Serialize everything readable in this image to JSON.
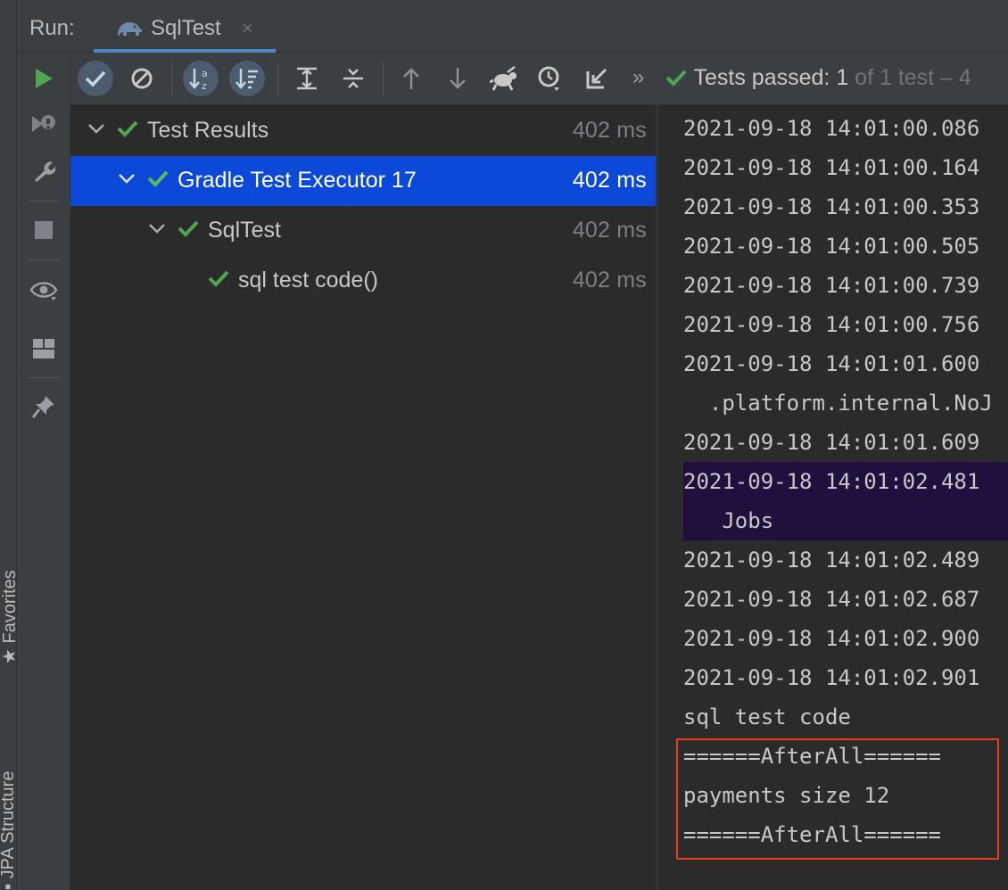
{
  "side_tabs": {
    "favorites": "Favorites",
    "jpa_structure": "JPA Structure"
  },
  "run_panel": {
    "label": "Run:",
    "tab": {
      "title": "SqlTest",
      "close": "×"
    }
  },
  "status": {
    "prefix": "Tests passed:",
    "count": "1",
    "suffix": "of 1 test – 4"
  },
  "toolbar": {
    "more": "»",
    "buttons": [
      "rerun-icon",
      "show-passed-icon",
      "show-ignored-icon",
      "sort-alpha-icon",
      "sort-duration-icon",
      "expand-all-icon",
      "collapse-all-icon",
      "prev-failed-icon",
      "next-failed-icon",
      "import-tests-icon",
      "history-icon",
      "export-icon"
    ]
  },
  "tree": {
    "rows": [
      {
        "label": "Test Results",
        "duration": "402 ms"
      },
      {
        "label": "Gradle Test Executor 17",
        "duration": "402 ms"
      },
      {
        "label": "SqlTest",
        "duration": "402 ms"
      },
      {
        "label": "sql test code()",
        "duration": "402 ms"
      }
    ]
  },
  "console": {
    "lines": [
      "2021-09-18 14:01:00.086",
      "2021-09-18 14:01:00.164",
      "2021-09-18 14:01:00.353",
      "2021-09-18 14:01:00.505",
      "2021-09-18 14:01:00.739",
      "2021-09-18 14:01:00.756",
      "2021-09-18 14:01:01.600",
      "  .platform.internal.NoJ",
      "2021-09-18 14:01:01.609",
      "2021-09-18 14:01:02.481",
      "   Jobs",
      "2021-09-18 14:01:02.489",
      "2021-09-18 14:01:02.687",
      "2021-09-18 14:01:02.900",
      "2021-09-18 14:01:02.901",
      "sql test code",
      "======AfterAll======",
      "payments size 12",
      "======AfterAll======"
    ]
  },
  "colors": {
    "pass_green": "#4fa552",
    "selection": "#0d49d9",
    "annotation_red": "#e5401e"
  }
}
